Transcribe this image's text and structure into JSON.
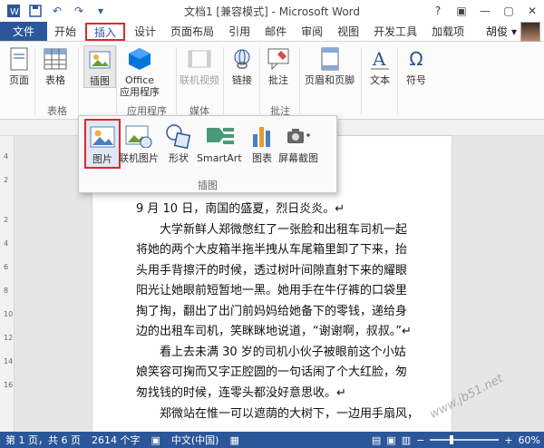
{
  "window": {
    "title": "文档1 [兼容模式] - Microsoft Word",
    "controls": [
      "?",
      "▣",
      "—",
      "▢",
      "✕"
    ]
  },
  "qat": {
    "icons": [
      "word-logo-icon",
      "save-icon",
      "undo-icon",
      "redo-icon",
      "customize-icon"
    ]
  },
  "tabs": {
    "file": "文件",
    "items": [
      "开始",
      "插入",
      "设计",
      "页面布局",
      "引用",
      "邮件",
      "审阅",
      "视图",
      "开发工具",
      "加载项"
    ],
    "active": "插入",
    "user": "胡俊"
  },
  "ribbon": {
    "buttons": {
      "page": "页面",
      "table": "表格",
      "illustration": "插图",
      "office_apps": "Office\n应用程序",
      "online_video": "联机视频",
      "links": "链接",
      "comment": "批注",
      "header_footer": "页眉和页脚",
      "text": "文本",
      "symbol": "符号"
    },
    "groups": {
      "table": "表格",
      "apps": "应用程序",
      "media": "媒体",
      "comments": "批注"
    }
  },
  "dropdown": {
    "group_label": "插图",
    "items": [
      "图片",
      "联机图片",
      "形状",
      "SmartArt",
      "图表",
      "屏幕截图"
    ],
    "selected": "图片"
  },
  "vruler": [
    "4",
    "2",
    "2",
    "4",
    "6",
    "8",
    "10",
    "12",
    "14",
    "16"
  ],
  "document": {
    "paragraphs": [
      "9 月 10 日，南国的盛夏，烈日炎炎。↵",
      "大学新鲜人郑微憋红了一张脸和出租车司机一起",
      "将她的两个大皮箱半拖半拽从车尾箱里卸了下来，抬",
      "头用手背擦汗的时候，透过树叶间隙直射下来的耀眼",
      "阳光让她眼前短暂地一黑。她用手在牛仔裤的口袋里",
      "掏了掏，翻出了出门前妈妈给她备下的零钱，递给身",
      "边的出租车司机，笑眯眯地说道，“谢谢啊，叔叔。”↵",
      "看上去未满 30 岁的司机小伙子被眼前这个小姑",
      "娘笑容可掬而又字正腔圆的一句话闹了个大红脸，匆",
      "匆找钱的时候，连零头都没好意思收。↵",
      "郑微站在惟一可以遮荫的大树下，一边用手扇风，"
    ]
  },
  "status": {
    "page": "第 1 页，共 6 页",
    "words": "2614 个字",
    "lang": "中文(中国)",
    "zoom": "60%",
    "zoom_fraction": 0.6
  },
  "watermark": "www.jb51.net"
}
